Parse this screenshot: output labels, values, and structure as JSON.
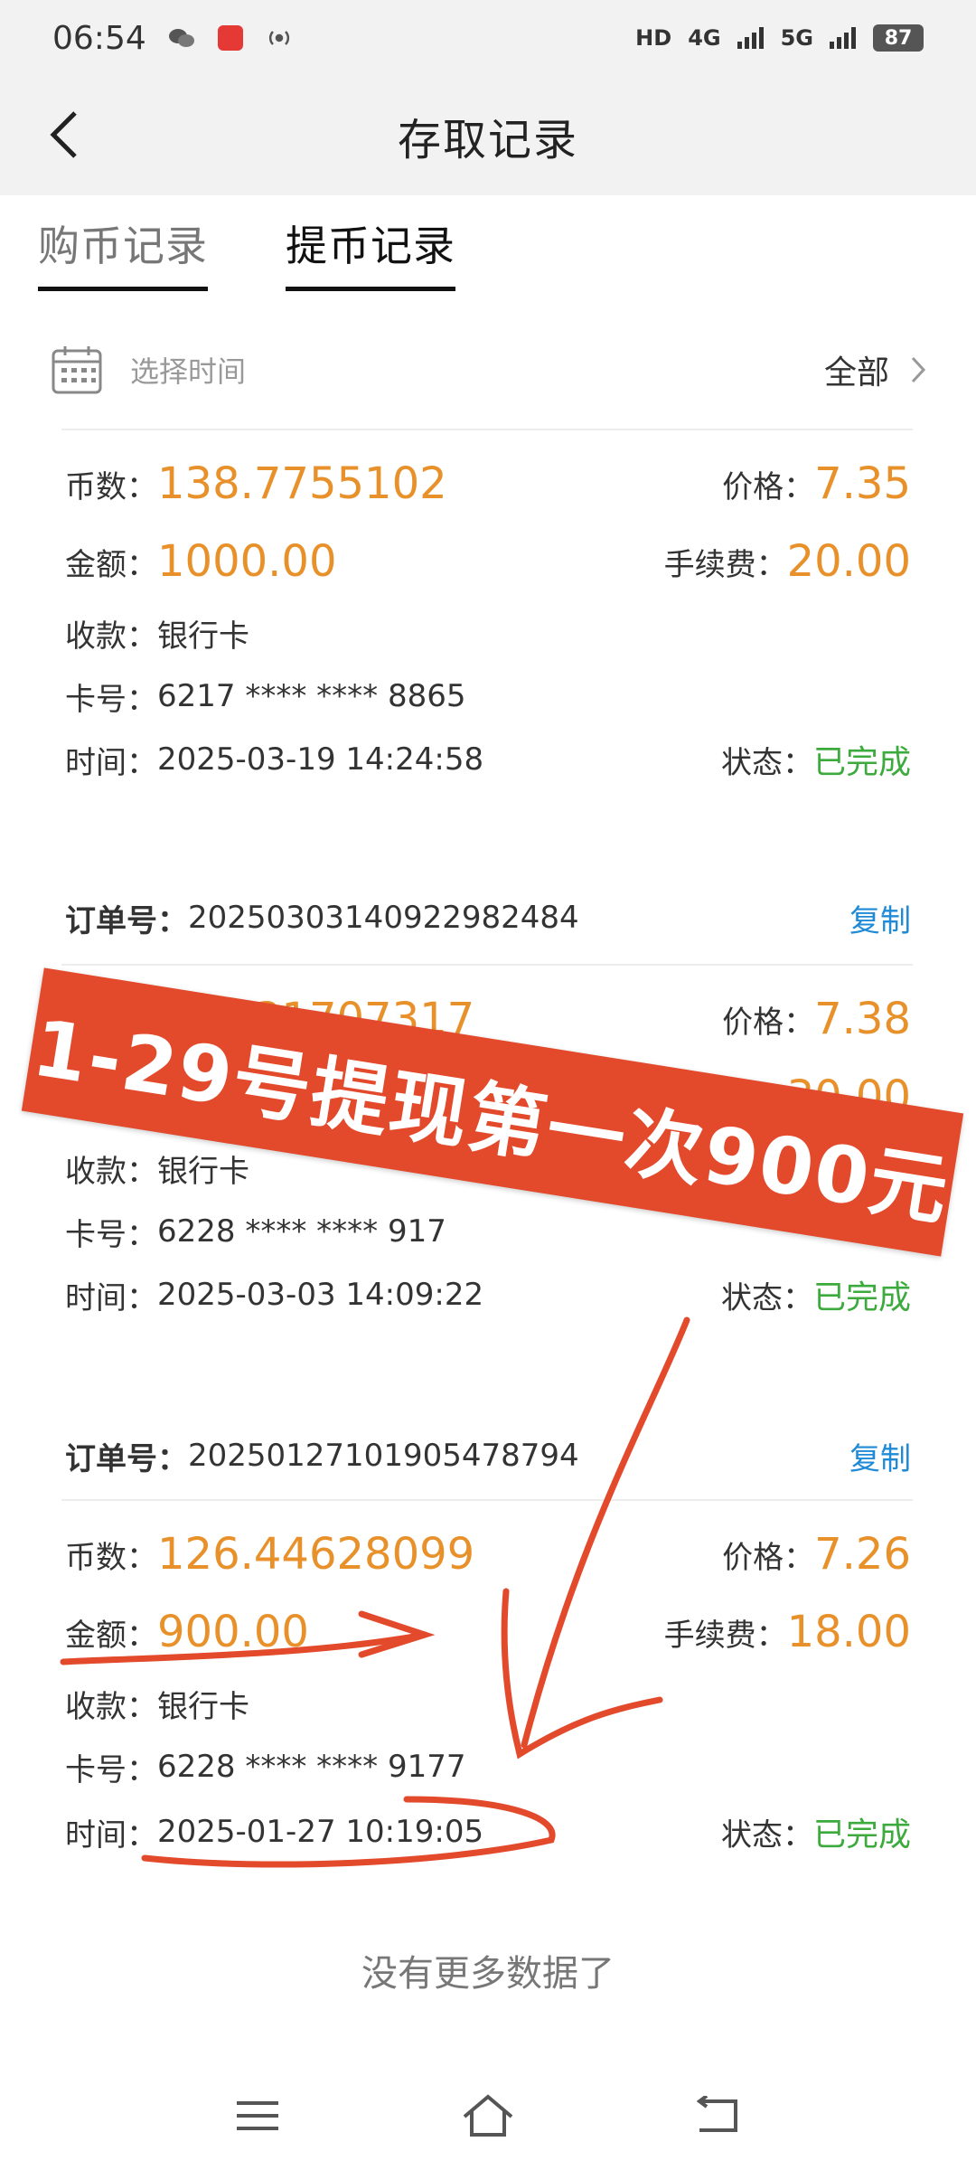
{
  "status_bar": {
    "time": "06:54",
    "network_hd": "HD",
    "network_4g": "4G",
    "network_5g": "5G",
    "battery": "87"
  },
  "header": {
    "title": "存取记录"
  },
  "tabs": [
    {
      "label": "购币记录",
      "active": false
    },
    {
      "label": "提币记录",
      "active": true
    }
  ],
  "filter": {
    "label": "选择时间",
    "value": "全部"
  },
  "labels": {
    "coins": "币数：",
    "price": "价格：",
    "amount": "金额：",
    "fee": "手续费：",
    "receive": "收款：",
    "card": "卡号：",
    "time": "时间：",
    "status": "状态：",
    "order": "订单号：",
    "copy": "复制"
  },
  "records": [
    {
      "coins": "138.7755102",
      "price": "7.35",
      "amount": "1000.00",
      "fee": "20.00",
      "receive": "银行卡",
      "card": "6217 **** **** 8865",
      "time": "2025-03-19 14:24:58",
      "status": "已完成"
    },
    {
      "order_no": "20250303140922982484",
      "coins": "207.31707317",
      "price": "7.38",
      "amount": "",
      "fee": "30.00",
      "receive": "银行卡",
      "card": "6228 **** **** 917",
      "time": "2025-03-03 14:09:22",
      "status": "已完成"
    },
    {
      "order_no": "20250127101905478794",
      "coins": "126.44628099",
      "price": "7.26",
      "amount": "900.00",
      "fee": "18.00",
      "receive": "银行卡",
      "card": "6228 **** **** 9177",
      "time": "2025-01-27 10:19:05",
      "status": "已完成"
    }
  ],
  "footer": {
    "no_more": "没有更多数据了"
  },
  "annotation": {
    "banner_text": "1-29号提现第一次900元",
    "color": "#e34a2c"
  },
  "colors": {
    "accent_orange": "#e8912b",
    "status_green": "#3caa3c",
    "copy_blue": "#1f8ad6"
  }
}
